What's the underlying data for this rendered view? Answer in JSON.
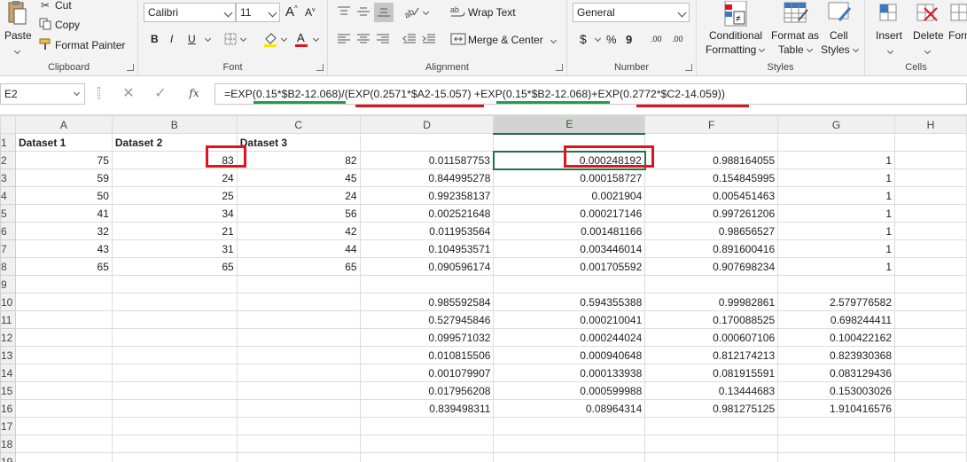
{
  "ribbon": {
    "clipboard": {
      "cut": "Cut",
      "copy": "Copy",
      "paste": "Paste",
      "format_painter": "Format Painter",
      "label": "Clipboard"
    },
    "font": {
      "name": "Calibri",
      "size": "11",
      "label": "Font",
      "bold": "B",
      "italic": "I",
      "underline": "U",
      "grow": "A",
      "shrink": "A"
    },
    "alignment": {
      "wrap_text": "Wrap Text",
      "merge_center": "Merge & Center",
      "label": "Alignment"
    },
    "number": {
      "format": "General",
      "currency": "$",
      "percent": "%",
      "comma": "9",
      "inc_dec": ".00",
      "dec_dec": ".00",
      "label": "Number"
    },
    "styles": {
      "conditional": "Conditional",
      "formatting": "Formatting",
      "format_as": "Format as",
      "table": "Table",
      "cell": "Cell",
      "cell_styles": "Styles",
      "label": "Styles"
    },
    "cells": {
      "insert": "Insert",
      "delete": "Delete",
      "format": "Form",
      "label": "Cells"
    }
  },
  "formula_bar": {
    "name_box": "E2",
    "fx": "fx",
    "formula": "=EXP(0.15*$B2-12.068)/(EXP(0.2571*$A2-15.057) +EXP(0.15*$B2-12.068)+EXP(0.2772*$C2-14.059))"
  },
  "sheet": {
    "columns": [
      "A",
      "B",
      "C",
      "D",
      "E",
      "F",
      "G",
      "H"
    ],
    "rows": [
      [
        "1",
        "Dataset 1",
        "Dataset 2",
        "Dataset 3",
        "",
        "",
        "",
        "",
        ""
      ],
      [
        "2",
        "75",
        "83",
        "82",
        "0.011587753",
        "0.000248192",
        "0.988164055",
        "1",
        ""
      ],
      [
        "3",
        "59",
        "24",
        "45",
        "0.844995278",
        "0.000158727",
        "0.154845995",
        "1",
        ""
      ],
      [
        "4",
        "50",
        "25",
        "24",
        "0.992358137",
        "0.0021904",
        "0.005451463",
        "1",
        ""
      ],
      [
        "5",
        "41",
        "34",
        "56",
        "0.002521648",
        "0.000217146",
        "0.997261206",
        "1",
        ""
      ],
      [
        "6",
        "32",
        "21",
        "42",
        "0.011953564",
        "0.001481166",
        "0.98656527",
        "1",
        ""
      ],
      [
        "7",
        "43",
        "31",
        "44",
        "0.104953571",
        "0.003446014",
        "0.891600416",
        "1",
        ""
      ],
      [
        "8",
        "65",
        "65",
        "65",
        "0.090596174",
        "0.001705592",
        "0.907698234",
        "1",
        ""
      ],
      [
        "9",
        "",
        "",
        "",
        "",
        "",
        "",
        "",
        ""
      ],
      [
        "10",
        "",
        "",
        "",
        "0.985592584",
        "0.594355388",
        "0.99982861",
        "2.579776582",
        ""
      ],
      [
        "11",
        "",
        "",
        "",
        "0.527945846",
        "0.000210041",
        "0.170088525",
        "0.698244411",
        ""
      ],
      [
        "12",
        "",
        "",
        "",
        "0.099571032",
        "0.000244024",
        "0.000607106",
        "0.100422162",
        ""
      ],
      [
        "13",
        "",
        "",
        "",
        "0.010815506",
        "0.000940648",
        "0.812174213",
        "0.823930368",
        ""
      ],
      [
        "14",
        "",
        "",
        "",
        "0.001079907",
        "0.000133938",
        "0.081915591",
        "0.083129436",
        ""
      ],
      [
        "15",
        "",
        "",
        "",
        "0.017956208",
        "0.000599988",
        "0.13444683",
        "0.153003026",
        ""
      ],
      [
        "16",
        "",
        "",
        "",
        "0.839498311",
        "0.08964314",
        "0.981275125",
        "1.910416576",
        ""
      ],
      [
        "17",
        "",
        "",
        "",
        "",
        "",
        "",
        "",
        ""
      ],
      [
        "18",
        "",
        "",
        "",
        "",
        "",
        "",
        "",
        ""
      ],
      [
        "19",
        "",
        "",
        "",
        "",
        "",
        "",
        "",
        ""
      ]
    ]
  },
  "colors": {
    "accent": "#217346",
    "highlight_red": "#e0141e",
    "highlight_green": "#1aa34a"
  }
}
